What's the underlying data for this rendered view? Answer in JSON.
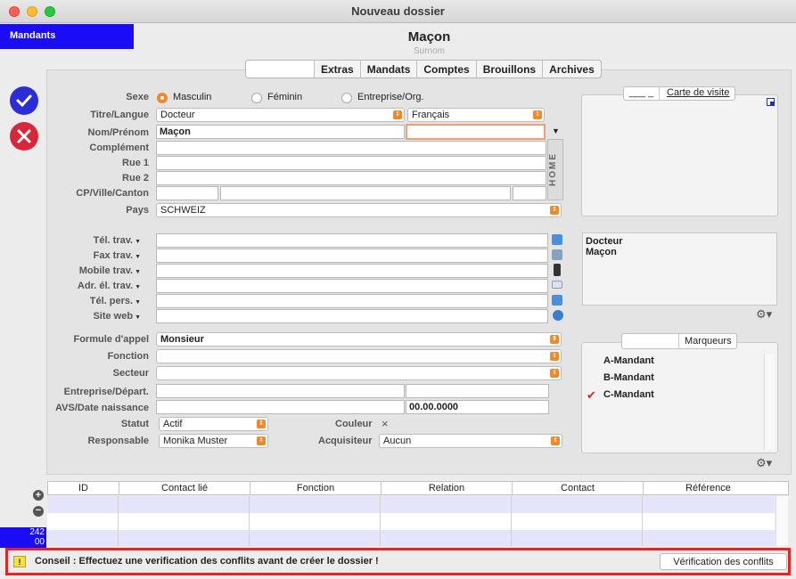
{
  "window": {
    "title": "Nouveau dossier"
  },
  "sidebar": {
    "mandants_label": "Mandants",
    "counter": "242\n00"
  },
  "header": {
    "name": "Maçon",
    "surnom_placeholder": "Surnom"
  },
  "tabs": [
    "",
    "Extras",
    "Mandats",
    "Comptes",
    "Brouillons",
    "Archives"
  ],
  "form": {
    "sexe_label": "Sexe",
    "sexe_options": [
      "Masculin",
      "Féminin",
      "Entreprise/Org."
    ],
    "sexe_selected": "Masculin",
    "titre_label": "Titre/Langue",
    "titre_value": "Docteur",
    "langue_value": "Français",
    "nom_label": "Nom/Prénom",
    "nom_value": "Maçon",
    "prenom_value": "",
    "complement_label": "Complément",
    "rue1_label": "Rue 1",
    "rue2_label": "Rue 2",
    "cp_label": "CP/Ville/Canton",
    "pays_label": "Pays",
    "pays_value": "SCHWEIZ",
    "home_label": "HOME",
    "tel_trav_label": "Tél. trav.",
    "fax_trav_label": "Fax trav.",
    "mobile_trav_label": "Mobile trav.",
    "adr_el_label": "Adr. él. trav.",
    "tel_pers_label": "Tél. pers.",
    "site_web_label": "Site web",
    "formule_label": "Formule d'appel",
    "formule_value": "Monsieur",
    "fonction_label": "Fonction",
    "secteur_label": "Secteur",
    "entreprise_label": "Entreprise/Départ.",
    "avs_label": "AVS/Date naissance",
    "date_value": "00.00.0000",
    "statut_label": "Statut",
    "statut_value": "Actif",
    "couleur_label": "Couleur",
    "couleur_value": "×",
    "responsable_label": "Responsable",
    "responsable_value": "Monika Muster",
    "acquisiteur_label": "Acquisiteur",
    "acquisiteur_value": "Aucun"
  },
  "carte": {
    "title": "Carte de visite",
    "field": "___  _"
  },
  "address_preview": {
    "line1": "Docteur",
    "line2": "Maçon"
  },
  "marqueurs": {
    "title": "Marqueurs",
    "items": [
      {
        "label": "A-Mandant",
        "checked": false
      },
      {
        "label": "B-Mandant",
        "checked": false
      },
      {
        "label": "C-Mandant",
        "checked": true
      }
    ]
  },
  "table": {
    "columns": [
      "ID",
      "Contact lié",
      "Fonction",
      "Relation",
      "Contact",
      "Référence"
    ]
  },
  "footer": {
    "message": "Conseil : Effectuez une verification des conflits avant de créer le dossier !",
    "button": "Vérification des conflits"
  },
  "colors": {
    "accent": "#1a0df5",
    "orange": "#f0892c",
    "ok": "#2c2dd9",
    "cancel": "#d9263a",
    "highlight": "#e52424"
  }
}
